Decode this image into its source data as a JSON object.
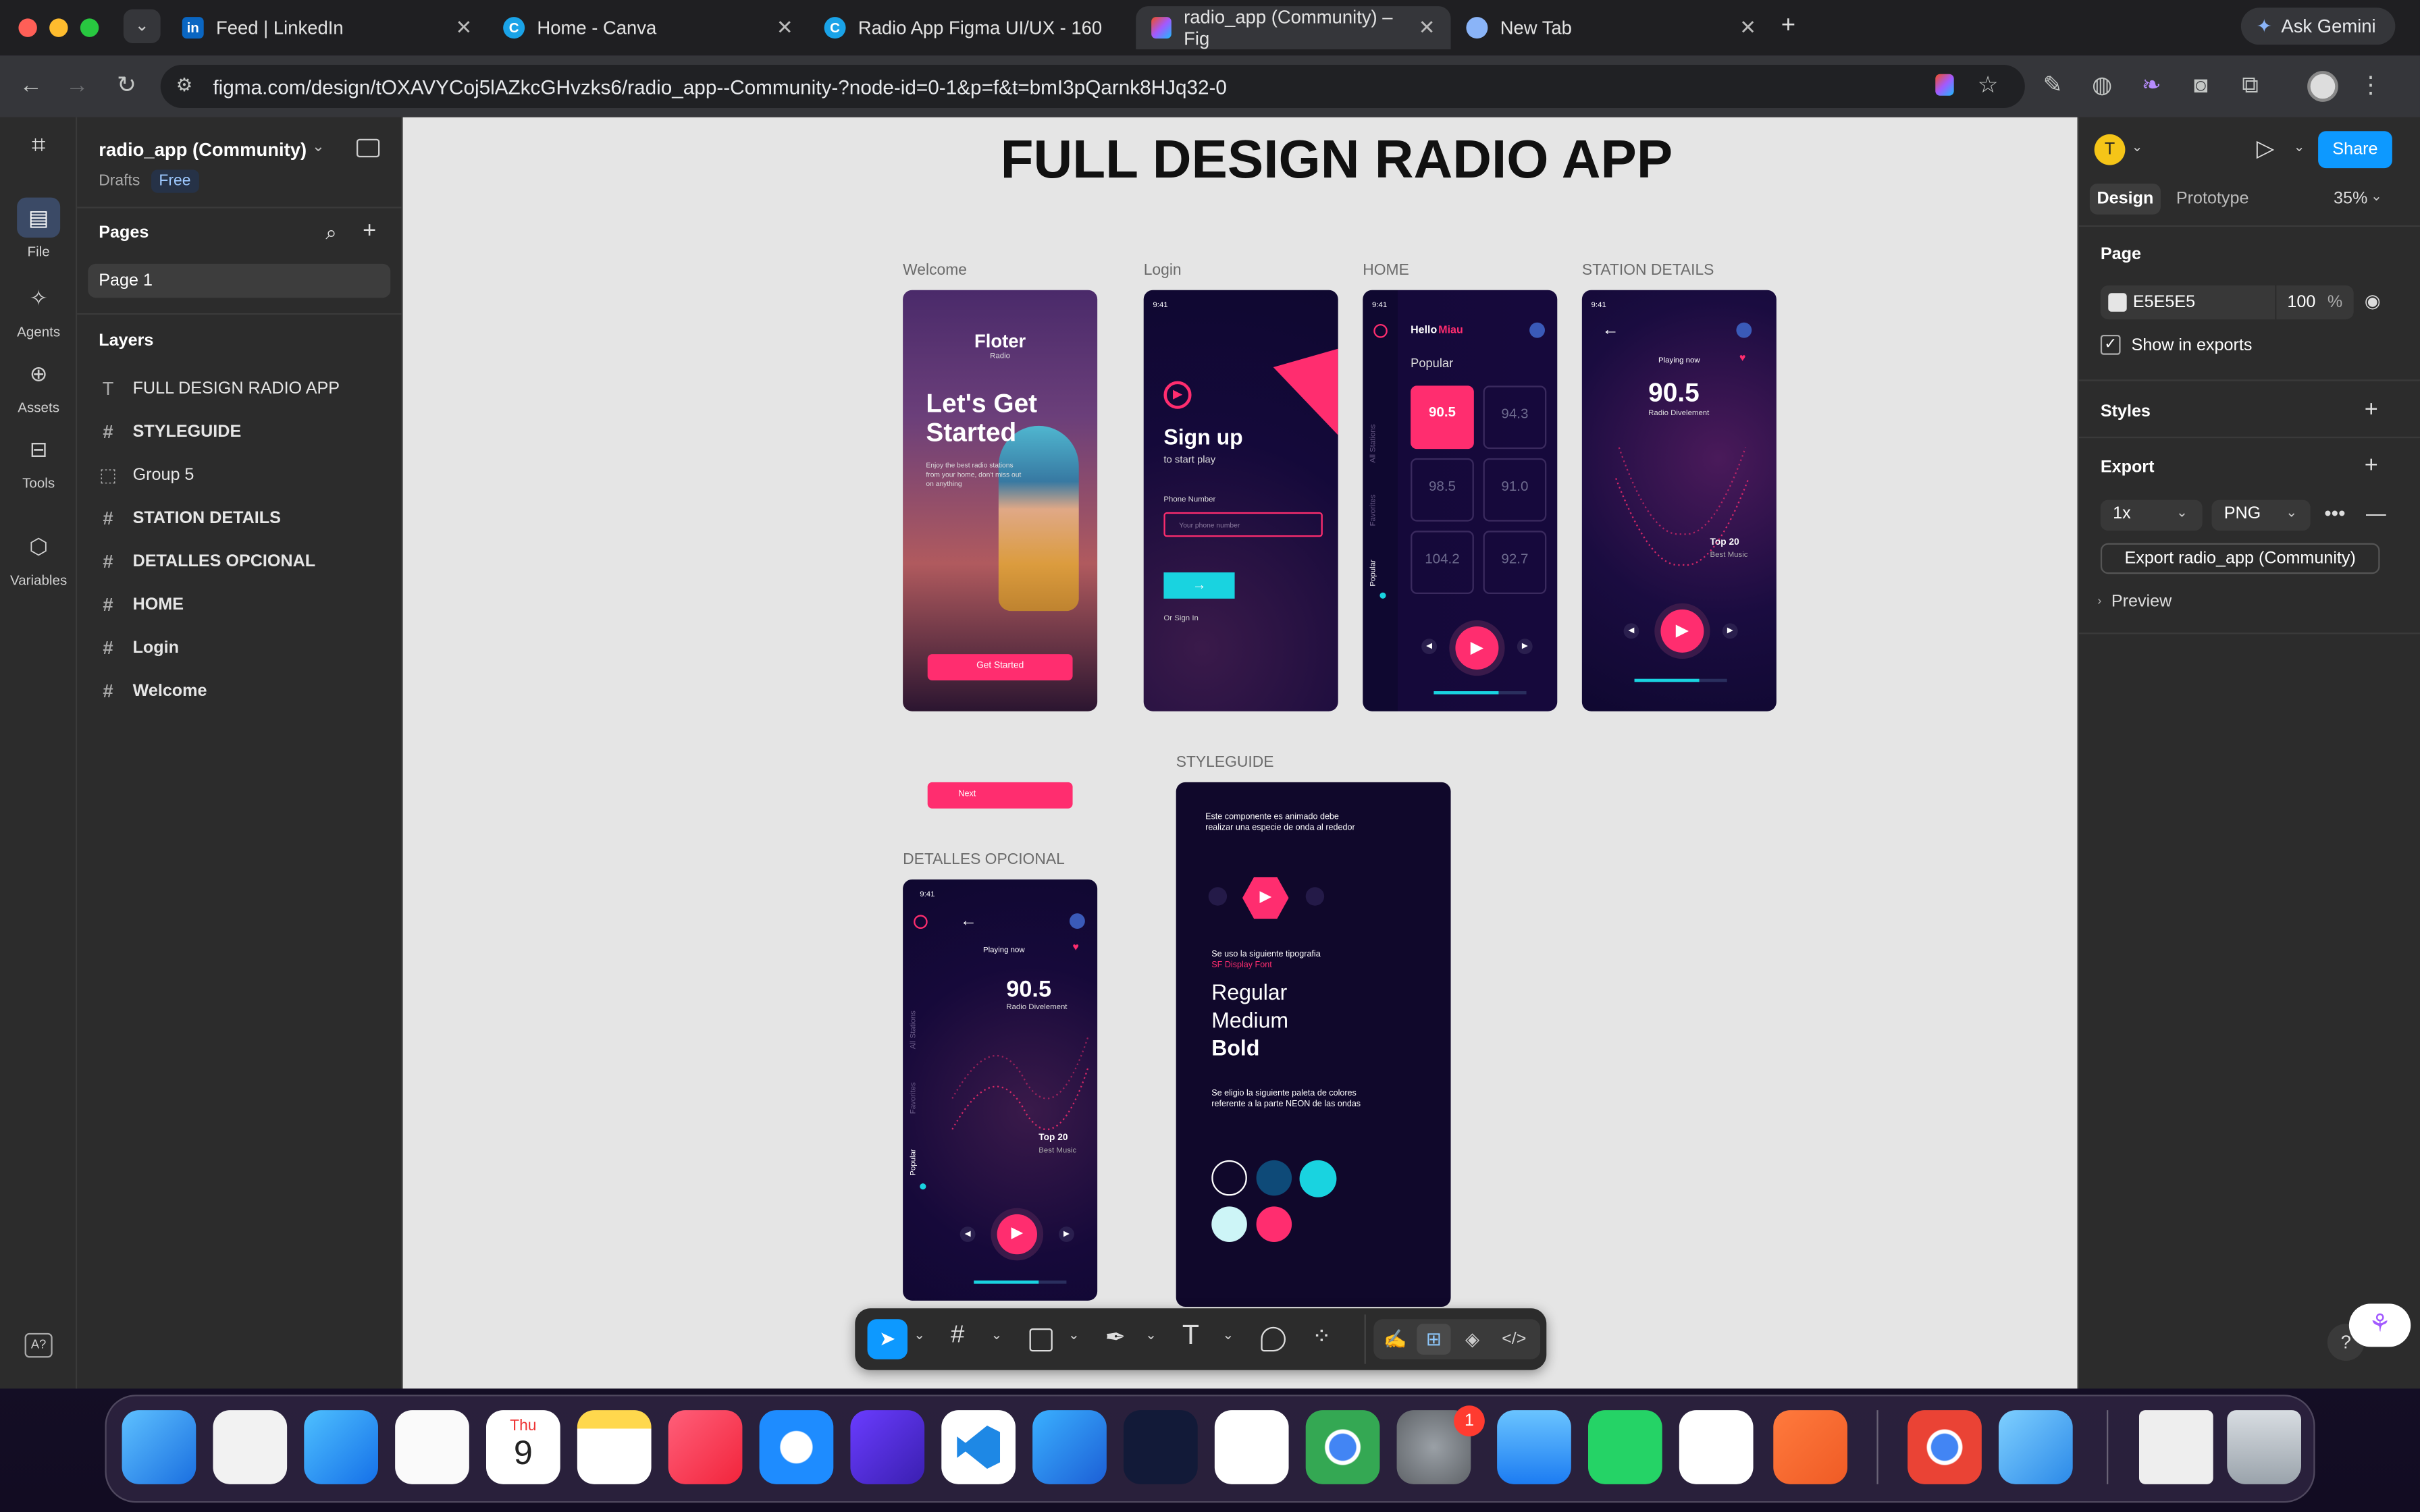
{
  "browser": {
    "tabs": [
      {
        "title": "Feed | LinkedIn"
      },
      {
        "title": "Home - Canva"
      },
      {
        "title": "Radio App Figma UI/UX - 160"
      },
      {
        "title": "radio_app (Community) – Fig"
      },
      {
        "title": "New Tab"
      }
    ],
    "new_tab": "+",
    "gemini": "Ask Gemini",
    "url": "figma.com/design/tOXAVYCoj5lAZkcGHvzks6/radio_app--Community-?node-id=0-1&p=f&t=bmI3pQarnk8HJq32-0"
  },
  "rail": {
    "items": [
      {
        "label": "File"
      },
      {
        "label": "Agents"
      },
      {
        "label": "Assets"
      },
      {
        "label": "Tools"
      },
      {
        "label": "Variables"
      }
    ]
  },
  "left_panel": {
    "file_name": "radio_app (Community)",
    "drafts": "Drafts",
    "plan": "Free",
    "pages_title": "Pages",
    "page": "Page 1",
    "layers_title": "Layers",
    "layers": [
      {
        "name": "FULL DESIGN RADIO APP",
        "type": "text"
      },
      {
        "name": "STYLEGUIDE",
        "type": "frame"
      },
      {
        "name": "Group 5",
        "type": "group"
      },
      {
        "name": "STATION DETAILS",
        "type": "frame"
      },
      {
        "name": "DETALLES OPCIONAL",
        "type": "frame"
      },
      {
        "name": "HOME",
        "type": "frame"
      },
      {
        "name": "Login",
        "type": "frame"
      },
      {
        "name": "Welcome",
        "type": "frame"
      }
    ]
  },
  "canvas": {
    "title": "FULL DESIGN RADIO APP",
    "frames": {
      "welcome": "Welcome",
      "login": "Login",
      "home": "HOME",
      "station": "STATION DETAILS",
      "detalles": "DETALLES OPCIONAL",
      "styleguide": "STYLEGUIDE"
    },
    "welcome": {
      "logo": "Floter",
      "logo_sub": "Radio",
      "headline1": "Let's Get",
      "headline2": "Started",
      "body": "Enjoy the best radio stations from your home, don't miss out on anything",
      "cta": "Get Started"
    },
    "login": {
      "title": "Sign up",
      "subtitle": "to start play",
      "field_label": "Phone Number",
      "placeholder": "Your phone number",
      "or_sign_in": "Or Sign In",
      "time": "9:41"
    },
    "home": {
      "greeting": "Hello",
      "name": "Miau",
      "popular": "Popular",
      "tabs": [
        "All Stations",
        "Favorites",
        "Popular"
      ],
      "stations": [
        "90.5",
        "94.3",
        "98.5",
        "91.0",
        "104.2",
        "92.7"
      ],
      "time": "9:41"
    },
    "station": {
      "playing": "Playing now",
      "freq": "90.5",
      "name": "Radio Divelement",
      "top": "Top 20",
      "top_sub": "Best Music",
      "time": "9:41"
    },
    "next_button": "Next",
    "detalles": {
      "playing": "Playing now",
      "freq": "90.5",
      "name": "Radio Divelement",
      "top": "Top 20",
      "top_sub": "Best Music",
      "tabs": [
        "All Stations",
        "Favorites",
        "Popular"
      ],
      "time": "9:41"
    },
    "styleguide": {
      "note": "Este componente es animado debe realizar una especie de onda al rededor",
      "typo_intro": "Se uso la siguiente tipografia",
      "font": "SF Display Font",
      "regular": "Regular",
      "medium": "Medium",
      "bold": "Bold",
      "palette_intro": "Se eligio la siguiente paleta de colores referente a la parte NEON de las ondas",
      "colors": [
        "#ffffff",
        "#0e4a78",
        "#19d3e0",
        "#cdf5f7",
        "#ff2d6f"
      ]
    }
  },
  "right_panel": {
    "avatar": "T",
    "share": "Share",
    "tabs": {
      "design": "Design",
      "prototype": "Prototype"
    },
    "zoom": "35%",
    "page_title": "Page",
    "page_color": "E5E5E5",
    "opacity": "100",
    "percent": "%",
    "show_in_exports": "Show in exports",
    "styles_title": "Styles",
    "export_title": "Export",
    "scale": "1x",
    "format": "PNG",
    "export_button": "Export radio_app (Community)",
    "preview": "Preview"
  },
  "dock": {
    "calendar_month": "Thu",
    "calendar_day": "9",
    "settings_badge": "1"
  },
  "colors": {
    "accent": "#0d99ff",
    "neon_pink": "#ff2d6f",
    "cyan": "#19d3e0",
    "navy": "#10082b",
    "canvas_bg": "#e5e5e5"
  }
}
